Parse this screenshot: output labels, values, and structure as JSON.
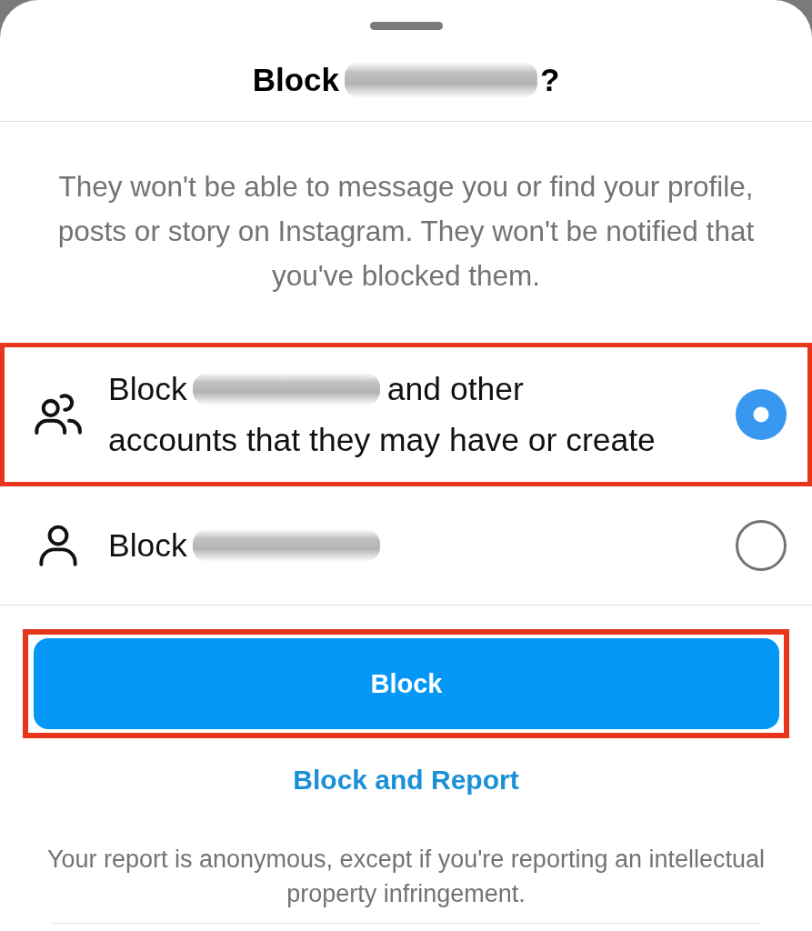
{
  "title": {
    "text_before_name": "Block",
    "name_blurred": true,
    "text_after_name": "?"
  },
  "description": "They won't be able to message you or find your profile, posts or story on Instagram. They won't be notified that you've blocked them.",
  "options": [
    {
      "kind": "group",
      "text_before_name": "Block",
      "name_blurred": true,
      "text_after_name": "and other",
      "second_line": "accounts that they may have or create",
      "selected": true,
      "highlighted": true
    },
    {
      "kind": "single",
      "text_before_name": "Block",
      "name_blurred": true,
      "selected": false,
      "highlighted": false
    }
  ],
  "actions": [
    {
      "kind": "primary",
      "label": "Block",
      "highlighted": true
    },
    {
      "kind": "link",
      "label": "Block and Report",
      "highlighted": false
    }
  ],
  "footnote": "Your report is anonymous, except if you're reporting an intellectual property infringement."
}
